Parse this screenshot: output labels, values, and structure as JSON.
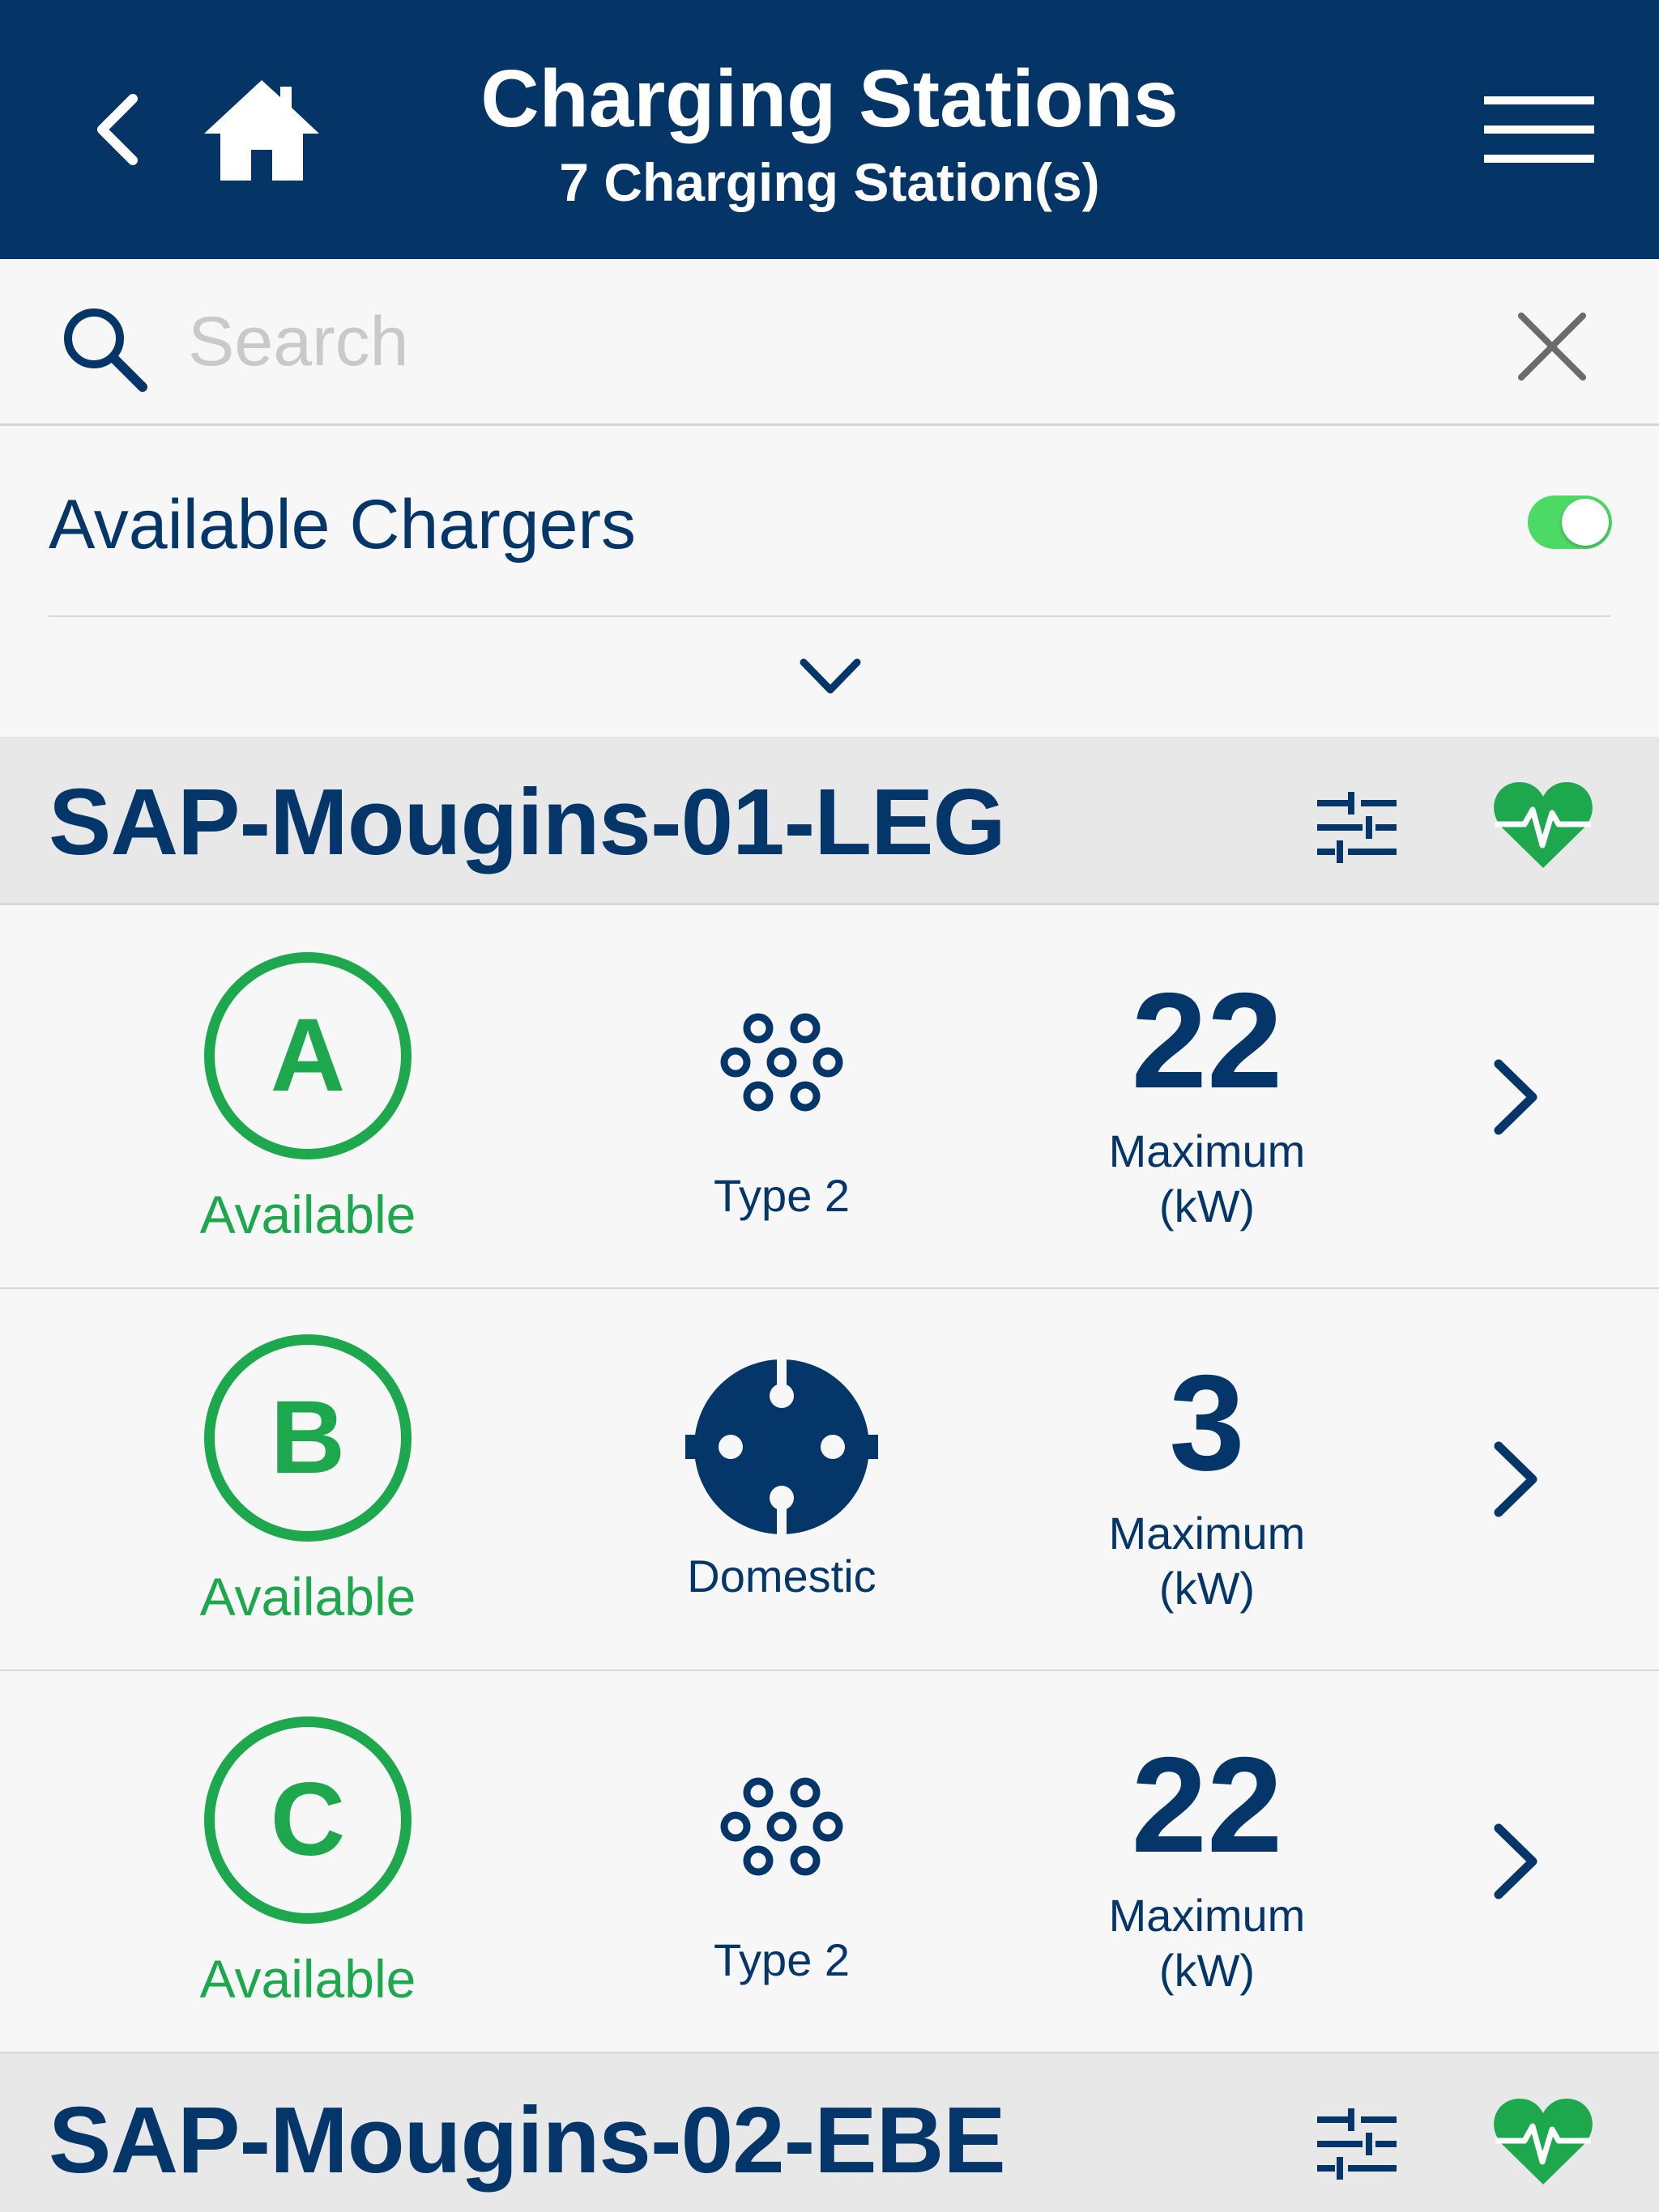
{
  "header": {
    "title": "Charging Stations",
    "subtitle": "7 Charging Station(s)"
  },
  "search": {
    "placeholder": "Search",
    "value": ""
  },
  "filter": {
    "label": "Available Chargers",
    "toggle_on": true
  },
  "stations": [
    {
      "name": "SAP-Mougins-01-LEG",
      "connectors": [
        {
          "letter": "A",
          "status": "Available",
          "plug_type": "Type 2",
          "power": "22",
          "power_label": "Maximum",
          "power_unit": "(kW)"
        },
        {
          "letter": "B",
          "status": "Available",
          "plug_type": "Domestic",
          "power": "3",
          "power_label": "Maximum",
          "power_unit": "(kW)"
        },
        {
          "letter": "C",
          "status": "Available",
          "plug_type": "Type 2",
          "power": "22",
          "power_label": "Maximum",
          "power_unit": "(kW)"
        }
      ]
    },
    {
      "name": "SAP-Mougins-02-EBE"
    }
  ],
  "icons": {
    "back": "chevron-left-icon",
    "home": "home-icon",
    "menu": "hamburger-menu-icon",
    "search": "search-icon",
    "clear": "close-icon",
    "expand": "chevron-down-icon",
    "settings": "sliders-icon",
    "health": "heartbeat-icon",
    "type2": "type-2-plug-icon",
    "domestic": "domestic-plug-icon",
    "row": "chevron-right-icon"
  },
  "colors": {
    "brand": "#053566",
    "available": "#1ea84e",
    "toggle": "#4cd964"
  }
}
